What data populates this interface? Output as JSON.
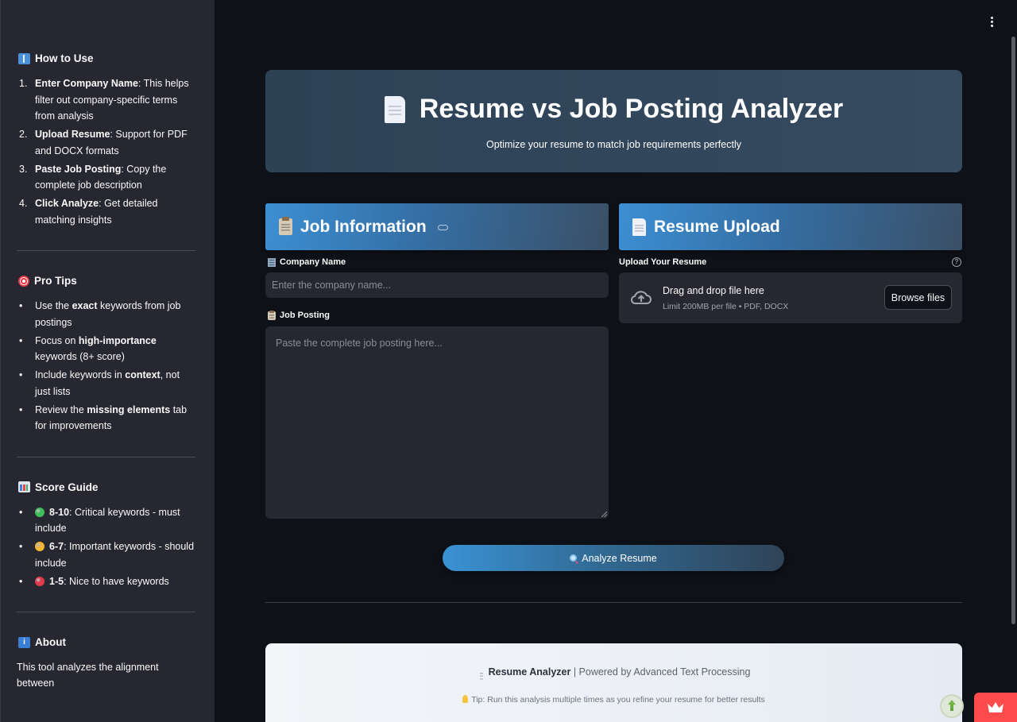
{
  "sidebar": {
    "how_to_use": {
      "heading": "How to Use",
      "items": [
        {
          "marker": "1.",
          "bold": "Enter Company Name",
          "text": ": This helps filter out company-specific terms from analysis"
        },
        {
          "marker": "2.",
          "bold": "Upload Resume",
          "text": ": Support for PDF and DOCX formats"
        },
        {
          "marker": "3.",
          "bold": "Paste Job Posting",
          "text": ": Copy the complete job description"
        },
        {
          "marker": "4.",
          "bold": "Click Analyze",
          "text": ": Get detailed matching insights"
        }
      ]
    },
    "pro_tips": {
      "heading": "Pro Tips",
      "items": [
        {
          "pre": "Use the ",
          "bold": "exact",
          "post": " keywords from job postings"
        },
        {
          "pre": "Focus on ",
          "bold": "high-importance",
          "post": " keywords (8+ score)"
        },
        {
          "pre": "Include keywords in ",
          "bold": "context",
          "post": ", not just lists"
        },
        {
          "pre": "Review the ",
          "bold": "missing elements",
          "post": " tab for improvements"
        }
      ]
    },
    "score_guide": {
      "heading": "Score Guide",
      "items": [
        {
          "color": "#3cbf5a",
          "bold": "8-10",
          "text": ": Critical keywords - must include"
        },
        {
          "color": "#f2b632",
          "bold": "6-7",
          "text": ": Important keywords - should include"
        },
        {
          "color": "#e23a4b",
          "bold": "1-5",
          "text": ": Nice to have keywords"
        }
      ]
    },
    "about": {
      "heading": "About",
      "text": "This tool analyzes the alignment between"
    }
  },
  "hero": {
    "title": "Resume vs Job Posting Analyzer",
    "subtitle": "Optimize your resume to match job requirements perfectly"
  },
  "job_panel": {
    "heading": "Job Information",
    "company_label": "Company Name",
    "company_placeholder": "Enter the company name...",
    "posting_label": "Job Posting",
    "posting_placeholder": "Paste the complete job posting here..."
  },
  "resume_panel": {
    "heading": "Resume Upload",
    "upload_label": "Upload Your Resume",
    "help_glyph": "?",
    "drop_title": "Drag and drop file here",
    "drop_limit": "Limit 200MB per file • PDF, DOCX",
    "browse_label": "Browse files"
  },
  "analyze_button": "Analyze Resume",
  "footer": {
    "brand": "Resume Analyzer",
    "powered": " | Powered by Advanced Text Processing",
    "tip": "Tip: Run this analysis multiple times as you refine your resume for better results"
  }
}
